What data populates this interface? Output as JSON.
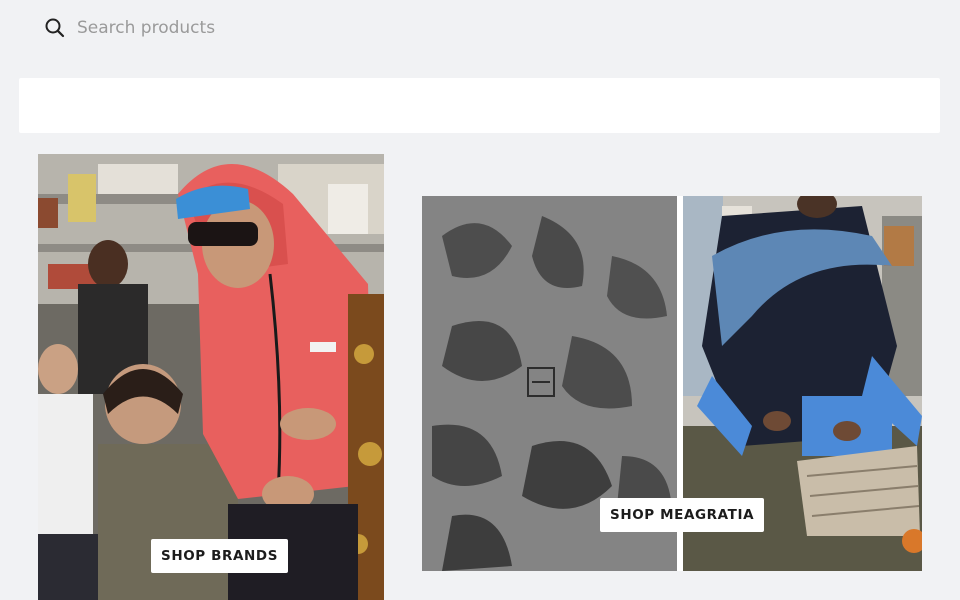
{
  "search": {
    "placeholder": "Search products",
    "value": ""
  },
  "promos": [
    {
      "label": "SHOP BRANDS",
      "image": "group-photo-red-hoodie"
    },
    {
      "label": "SHOP MEAGRATIA",
      "image": "floral-mesh-and-model-diptych"
    }
  ],
  "colors": {
    "background": "#f1f2f4",
    "surface": "#ffffff",
    "text": "#1c1c1c",
    "placeholder": "#9a9a9a",
    "hoodie": "#e8605e",
    "cap": "#3b8fd6"
  }
}
